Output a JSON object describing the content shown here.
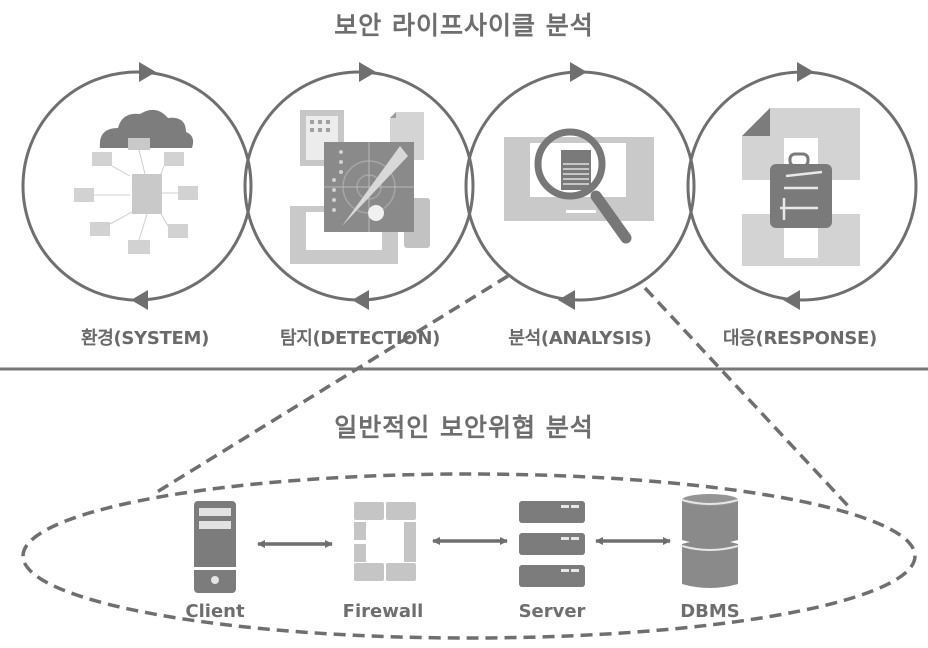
{
  "top_section": {
    "title": "보안 라이프사이클 분석",
    "stages": [
      {
        "id": "system",
        "label": "환경(SYSTEM)",
        "icon": "cloud-network-icon"
      },
      {
        "id": "detection",
        "label": "탐지(DETECTION)",
        "icon": "radar-detection-icon"
      },
      {
        "id": "analysis",
        "label": "분석(ANALYSIS)",
        "icon": "magnifier-document-icon"
      },
      {
        "id": "response",
        "label": "대응(RESPONSE)",
        "icon": "toolkit-document-icon"
      }
    ]
  },
  "bottom_section": {
    "title": "일반적인 보안위협 분석",
    "nodes": [
      {
        "id": "client",
        "label": "Client",
        "icon": "client-device-icon"
      },
      {
        "id": "firewall",
        "label": "Firewall",
        "icon": "firewall-icon"
      },
      {
        "id": "server",
        "label": "Server",
        "icon": "server-rack-icon"
      },
      {
        "id": "dbms",
        "label": "DBMS",
        "icon": "database-icon"
      }
    ],
    "connections": [
      {
        "from": "client",
        "to": "firewall",
        "direction": "bidirectional"
      },
      {
        "from": "firewall",
        "to": "server",
        "direction": "bidirectional"
      },
      {
        "from": "server",
        "to": "dbms",
        "direction": "bidirectional"
      }
    ],
    "zoom_source": "analysis"
  },
  "colors": {
    "stroke": "#6f6f6f",
    "icon_dark": "#7a7a7a",
    "icon_light": "#c8c8c8",
    "icon_mid": "#a8a8a8"
  }
}
